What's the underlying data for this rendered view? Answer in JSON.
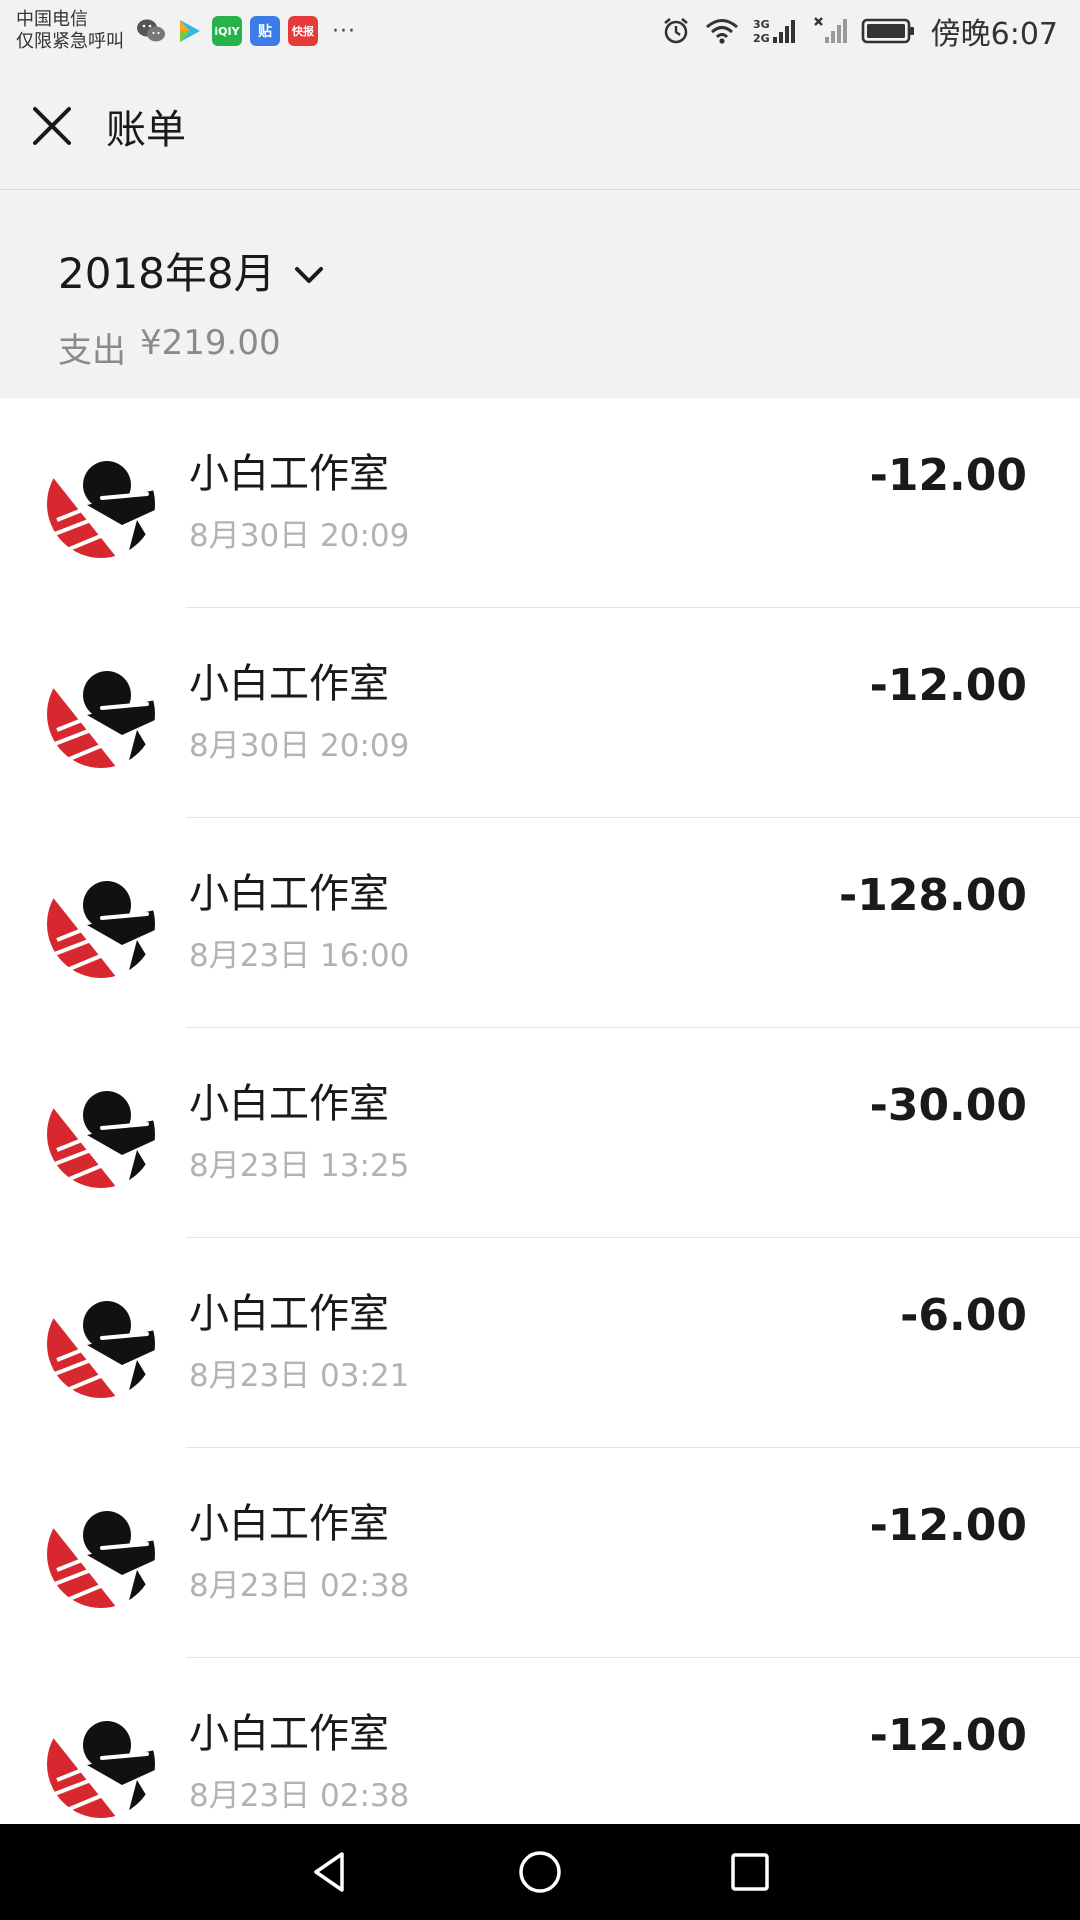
{
  "status_bar": {
    "carrier_line1": "中国电信",
    "carrier_line2": "仅限紧急呼叫",
    "app_icons": [
      "wechat-icon",
      "video-icon",
      "iqiyi-icon",
      "tieba-icon",
      "news-icon"
    ],
    "iqiyi_text": "iQIY",
    "tieba_text": "贴",
    "news_text": "快报",
    "more": "···",
    "network_label": "3G 2G",
    "time": "傍晚6:07"
  },
  "header": {
    "title": "账单"
  },
  "summary": {
    "month": "2018年8月",
    "expense_label": "支出",
    "expense_amount": "¥219.00"
  },
  "transactions": [
    {
      "name": "小白工作室",
      "time": "8月30日 20:09",
      "amount": "-12.00"
    },
    {
      "name": "小白工作室",
      "time": "8月30日 20:09",
      "amount": "-12.00"
    },
    {
      "name": "小白工作室",
      "time": "8月23日 16:00",
      "amount": "-128.00"
    },
    {
      "name": "小白工作室",
      "time": "8月23日 13:25",
      "amount": "-30.00"
    },
    {
      "name": "小白工作室",
      "time": "8月23日 03:21",
      "amount": "-6.00"
    },
    {
      "name": "小白工作室",
      "time": "8月23日 02:38",
      "amount": "-12.00"
    },
    {
      "name": "小白工作室",
      "time": "8月23日 02:38",
      "amount": "-12.00"
    }
  ],
  "colors": {
    "header_bg": "#f2f2f2",
    "secondary_text": "#b2b2b2",
    "summary_text": "#8a8a8a",
    "avatar_red": "#d7282f"
  },
  "nav": {
    "icons": [
      "back-icon",
      "home-icon",
      "recents-icon"
    ]
  }
}
